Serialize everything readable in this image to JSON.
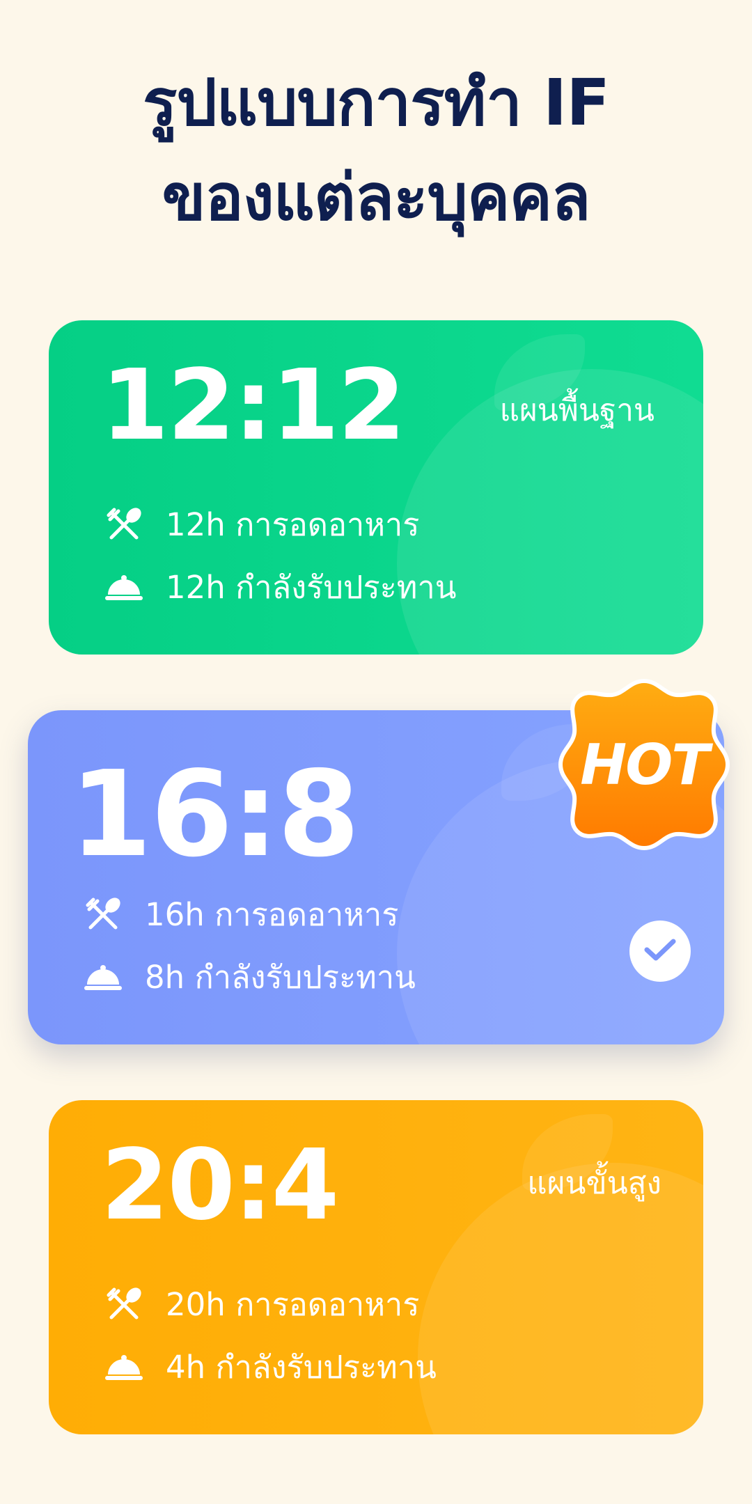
{
  "title": {
    "line1": "รูปแบบการทำ IF",
    "line2": "ของแต่ละบุคคล"
  },
  "plans": [
    {
      "ratio": "12:12",
      "plan_label": "แผนพื้นฐาน",
      "fasting_text": "12h การอดอาหาร",
      "eating_text": "12h กำลังรับประทาน",
      "color": "#05cf85"
    },
    {
      "ratio": "16:8",
      "badge": "HOT",
      "fasting_text": "16h การอดอาหาร",
      "eating_text": "8h กำลังรับประทาน",
      "selected": true,
      "color": "#7b96fb"
    },
    {
      "ratio": "20:4",
      "plan_label": "แผนขั้นสูง",
      "fasting_text": "20h การอดอาหาร",
      "eating_text": "4h กำลังรับประทาน",
      "color": "#ffad05"
    }
  ],
  "icons": {
    "fasting": "utensils-crossed-icon",
    "eating": "food-cloche-icon",
    "selected": "checkmark-icon"
  },
  "badge_color": "#ff8a00"
}
